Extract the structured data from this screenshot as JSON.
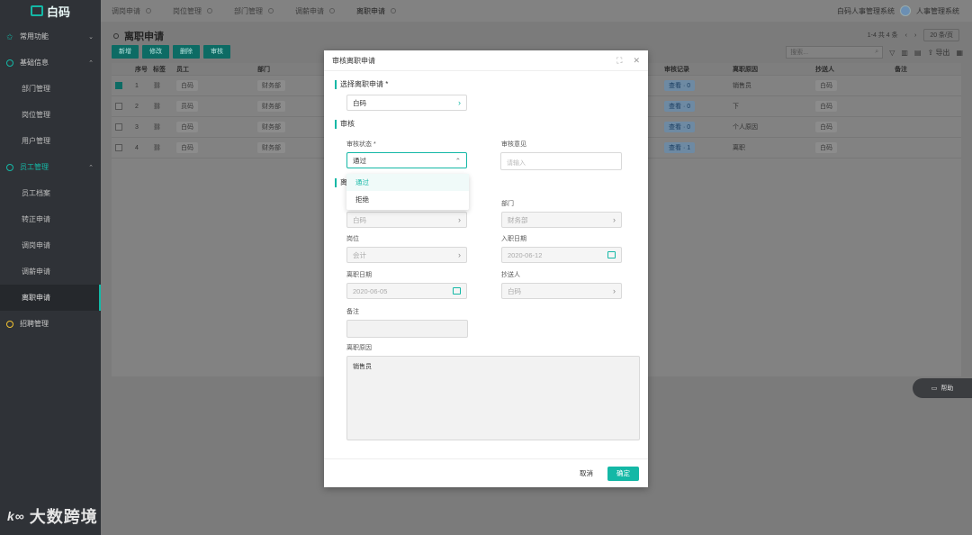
{
  "app": {
    "logo_text": "白码"
  },
  "sidebar": {
    "groups": [
      {
        "label": "常用功能"
      },
      {
        "label": "基础信息",
        "items": [
          "部门管理",
          "岗位管理",
          "用户管理"
        ]
      },
      {
        "label": "员工管理",
        "items": [
          "员工档案",
          "转正申请",
          "调岗申请",
          "调薪申请",
          "离职申请"
        ]
      },
      {
        "label": "招聘管理"
      }
    ]
  },
  "topbar": {
    "tabs": [
      "调岗申请",
      "岗位管理",
      "部门管理",
      "调薪申请",
      "离职申请"
    ],
    "right_link": "白码人事管理系统",
    "user_name": "人事管理系统"
  },
  "page": {
    "title": "离职申请",
    "pager": {
      "range": "1-4 共 4 条",
      "page_size": "20 条/页"
    },
    "buttons": [
      "新增",
      "修改",
      "删除",
      "审核"
    ],
    "search_placeholder": "搜索...",
    "export_label": "导出"
  },
  "table": {
    "columns": [
      "序号",
      "标签",
      "员工",
      "部门",
      "审核记录",
      "离职原因",
      "抄送人",
      "备注"
    ],
    "rows": [
      {
        "no": "1",
        "employee": "白码",
        "dept": "财务部",
        "audit": "查看 · 0",
        "reason": "销售员",
        "cc": "白码",
        "checked": true
      },
      {
        "no": "2",
        "employee": "员码",
        "dept": "财务部",
        "audit": "查看 · 0",
        "reason": "下",
        "cc": "白码",
        "checked": false
      },
      {
        "no": "3",
        "employee": "白码",
        "dept": "财务部",
        "audit": "查看 · 0",
        "reason": "个人原因",
        "cc": "白码",
        "checked": false
      },
      {
        "no": "4",
        "employee": "白码",
        "dept": "财务部",
        "audit": "查看 · 1",
        "reason": "离职",
        "cc": "白码",
        "checked": false
      }
    ]
  },
  "help": {
    "label": "帮助"
  },
  "modal": {
    "title": "审核离职申请",
    "section_select": "选择离职申请 *",
    "select_value": "白码",
    "section_audit": "审核",
    "audit_status_label": "审核状态 *",
    "audit_status_value": "通过",
    "audit_opinion_label": "审核意见",
    "audit_opinion_placeholder": "请输入",
    "options": [
      "通过",
      "拒绝"
    ],
    "section_info": "离",
    "employee_value": "白码",
    "dept_label": "部门",
    "dept_value": "财务部",
    "position_label": "岗位",
    "position_value": "会计",
    "hire_date_label": "入职日期",
    "hire_date_value": "2020-06-12",
    "leave_date_label": "离职日期",
    "leave_date_value": "2020-06-05",
    "cc_label": "抄送人",
    "cc_value": "白码",
    "remark_label": "备注",
    "reason_label": "离职原因",
    "reason_value": "销售员",
    "cancel_label": "取消",
    "ok_label": "确定"
  }
}
